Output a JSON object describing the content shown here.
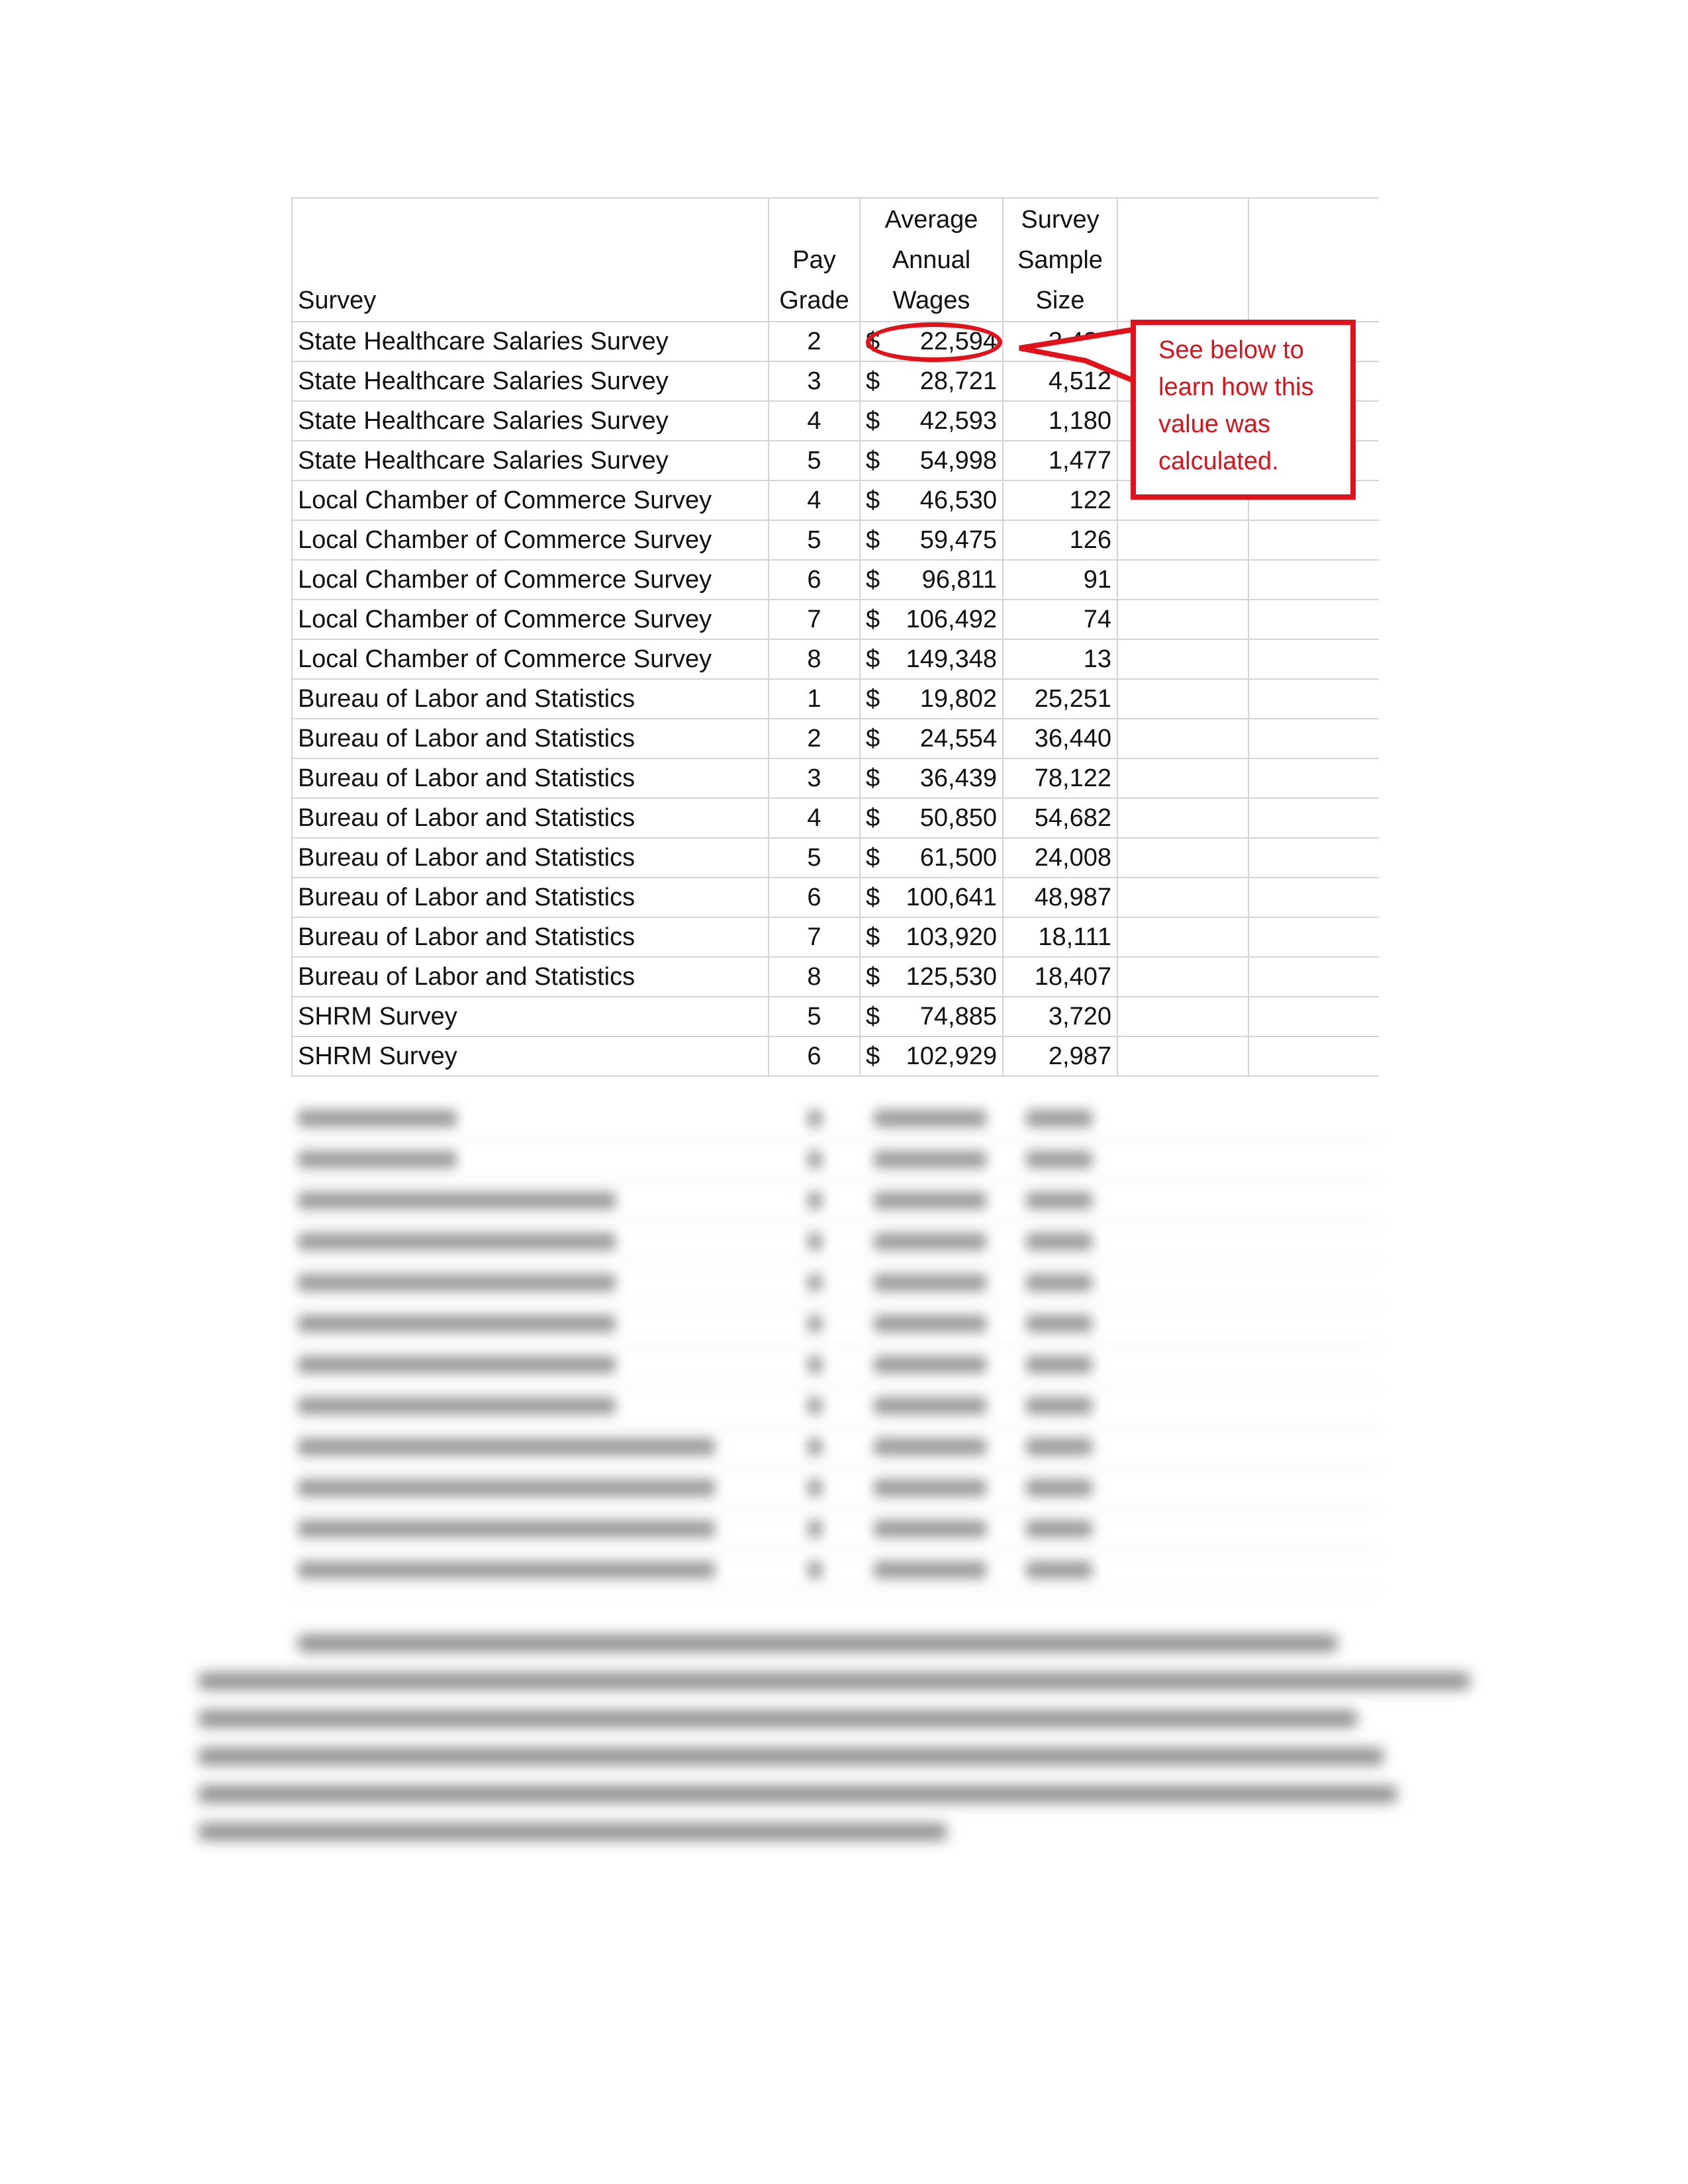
{
  "table": {
    "headers": {
      "survey": "Survey",
      "pay_grade": [
        "Pay",
        "Grade"
      ],
      "wages": [
        "Average",
        "Annual",
        "Wages"
      ],
      "sample": [
        "Survey",
        "Sample",
        "Size"
      ]
    },
    "rows": [
      {
        "survey": "State Healthcare Salaries Survey",
        "grade": "2",
        "wage": "22,594",
        "sample": "3,420"
      },
      {
        "survey": "State Healthcare Salaries Survey",
        "grade": "3",
        "wage": "28,721",
        "sample": "4,512"
      },
      {
        "survey": "State Healthcare Salaries Survey",
        "grade": "4",
        "wage": "42,593",
        "sample": "1,180"
      },
      {
        "survey": "State Healthcare Salaries Survey",
        "grade": "5",
        "wage": "54,998",
        "sample": "1,477"
      },
      {
        "survey": "Local Chamber of Commerce Survey",
        "grade": "4",
        "wage": "46,530",
        "sample": "122"
      },
      {
        "survey": "Local Chamber of Commerce Survey",
        "grade": "5",
        "wage": "59,475",
        "sample": "126"
      },
      {
        "survey": "Local Chamber of Commerce Survey",
        "grade": "6",
        "wage": "96,811",
        "sample": "91"
      },
      {
        "survey": "Local Chamber of Commerce Survey",
        "grade": "7",
        "wage": "106,492",
        "sample": "74"
      },
      {
        "survey": "Local Chamber of Commerce Survey",
        "grade": "8",
        "wage": "149,348",
        "sample": "13"
      },
      {
        "survey": "Bureau of Labor and Statistics",
        "grade": "1",
        "wage": "19,802",
        "sample": "25,251"
      },
      {
        "survey": "Bureau of Labor and Statistics",
        "grade": "2",
        "wage": "24,554",
        "sample": "36,440"
      },
      {
        "survey": "Bureau of Labor and Statistics",
        "grade": "3",
        "wage": "36,439",
        "sample": "78,122"
      },
      {
        "survey": "Bureau of Labor and Statistics",
        "grade": "4",
        "wage": "50,850",
        "sample": "54,682"
      },
      {
        "survey": "Bureau of Labor and Statistics",
        "grade": "5",
        "wage": "61,500",
        "sample": "24,008"
      },
      {
        "survey": "Bureau of Labor and Statistics",
        "grade": "6",
        "wage": "100,641",
        "sample": "48,987"
      },
      {
        "survey": "Bureau of Labor and Statistics",
        "grade": "7",
        "wage": "103,920",
        "sample": "18,111"
      },
      {
        "survey": "Bureau of Labor and Statistics",
        "grade": "8",
        "wage": "125,530",
        "sample": "18,407"
      },
      {
        "survey": "SHRM Survey",
        "grade": "5",
        "wage": "74,885",
        "sample": "3,720"
      },
      {
        "survey": "SHRM Survey",
        "grade": "6",
        "wage": "102,929",
        "sample": "2,987"
      }
    ],
    "currency_symbol": "$"
  },
  "callout": {
    "lines": [
      "See below to",
      "learn how this",
      "value was",
      "calculated."
    ],
    "color": "#e0121b"
  }
}
